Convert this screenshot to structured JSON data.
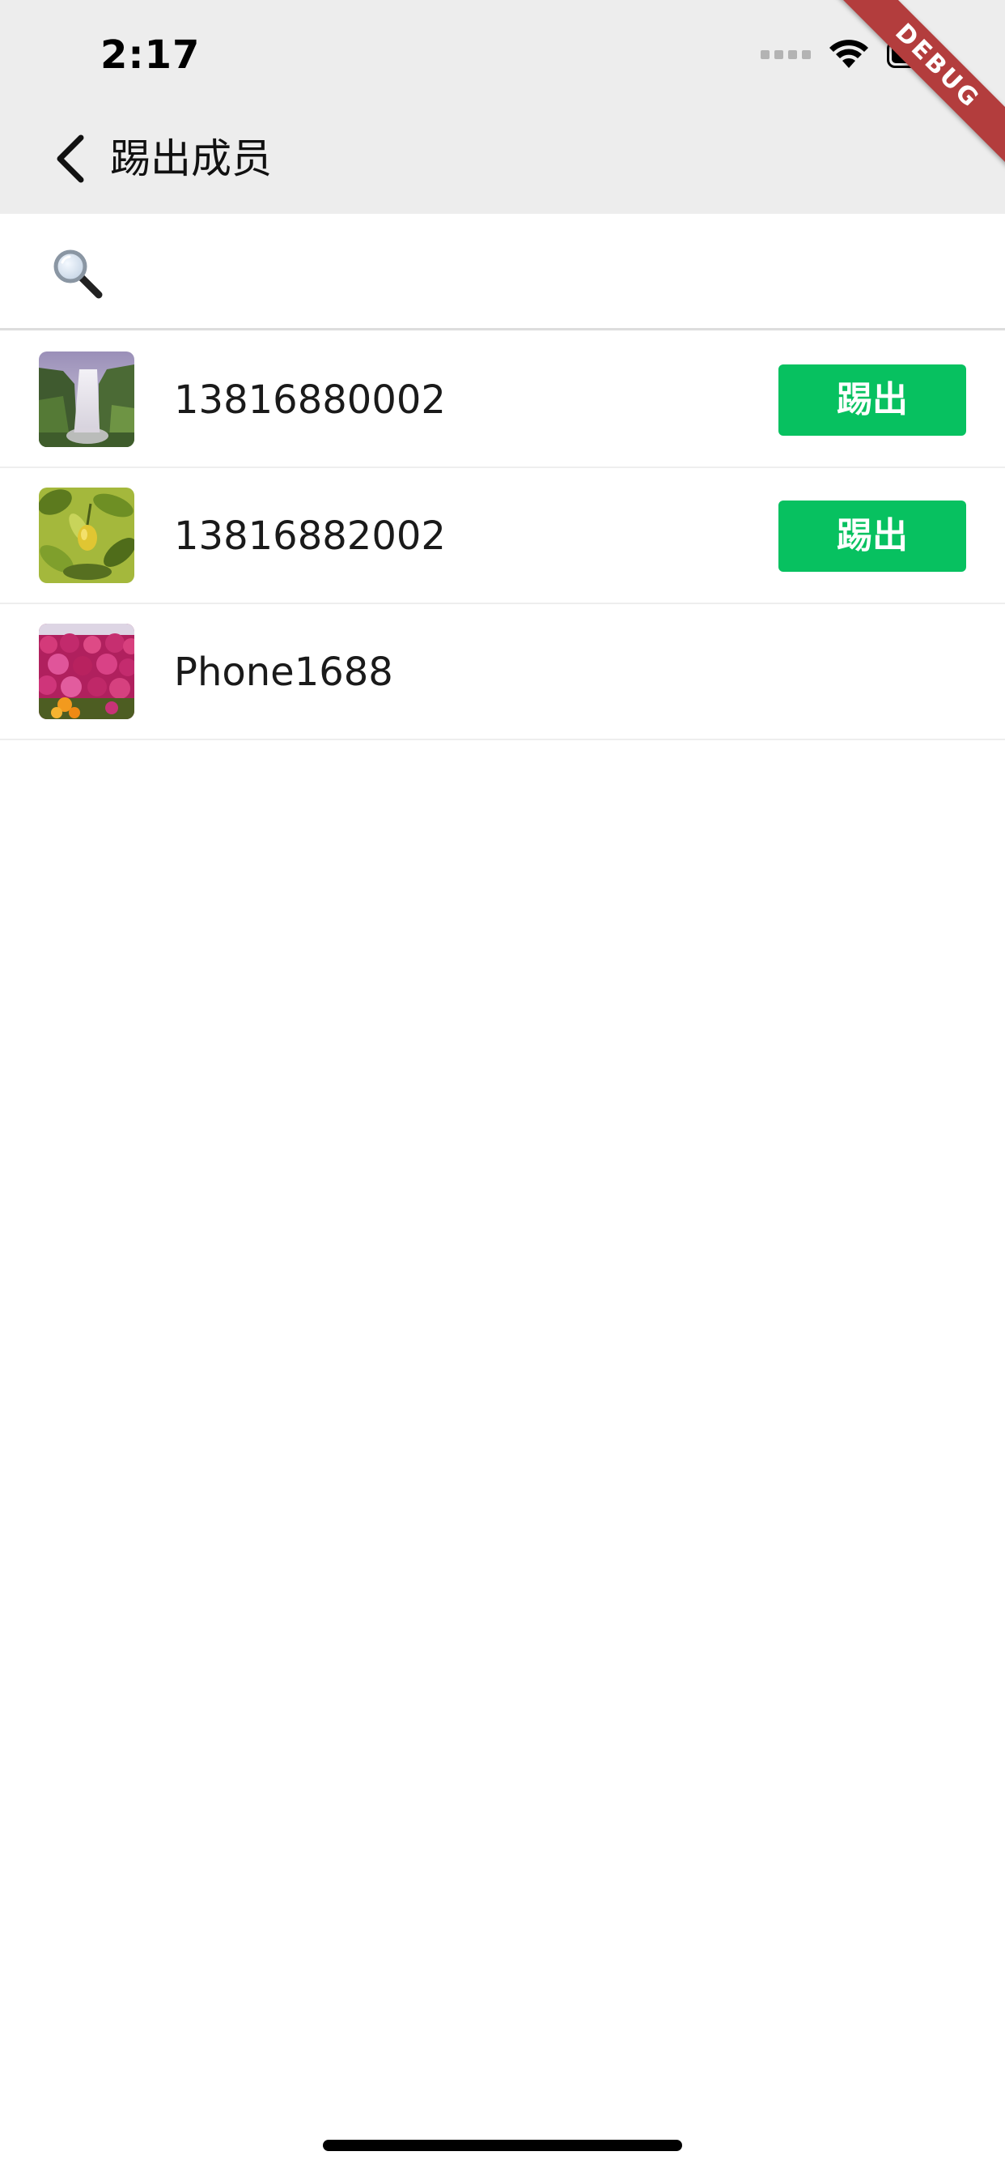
{
  "status_bar": {
    "time": "2:17"
  },
  "debug_banner": "DEBUG",
  "nav": {
    "title": "踢出成员"
  },
  "search": {
    "value": "",
    "placeholder": ""
  },
  "members": [
    {
      "name": "13816880002",
      "avatar": "waterfall-photo",
      "action": "踢出"
    },
    {
      "name": "13816882002",
      "avatar": "lemon-tree-photo",
      "action": "踢出"
    },
    {
      "name": "Phone1688",
      "avatar": "pink-flowers-photo"
    }
  ],
  "colors": {
    "header_bg": "#ededed",
    "kick_button": "#07c160",
    "debug_ribbon": "#b33d3d"
  }
}
